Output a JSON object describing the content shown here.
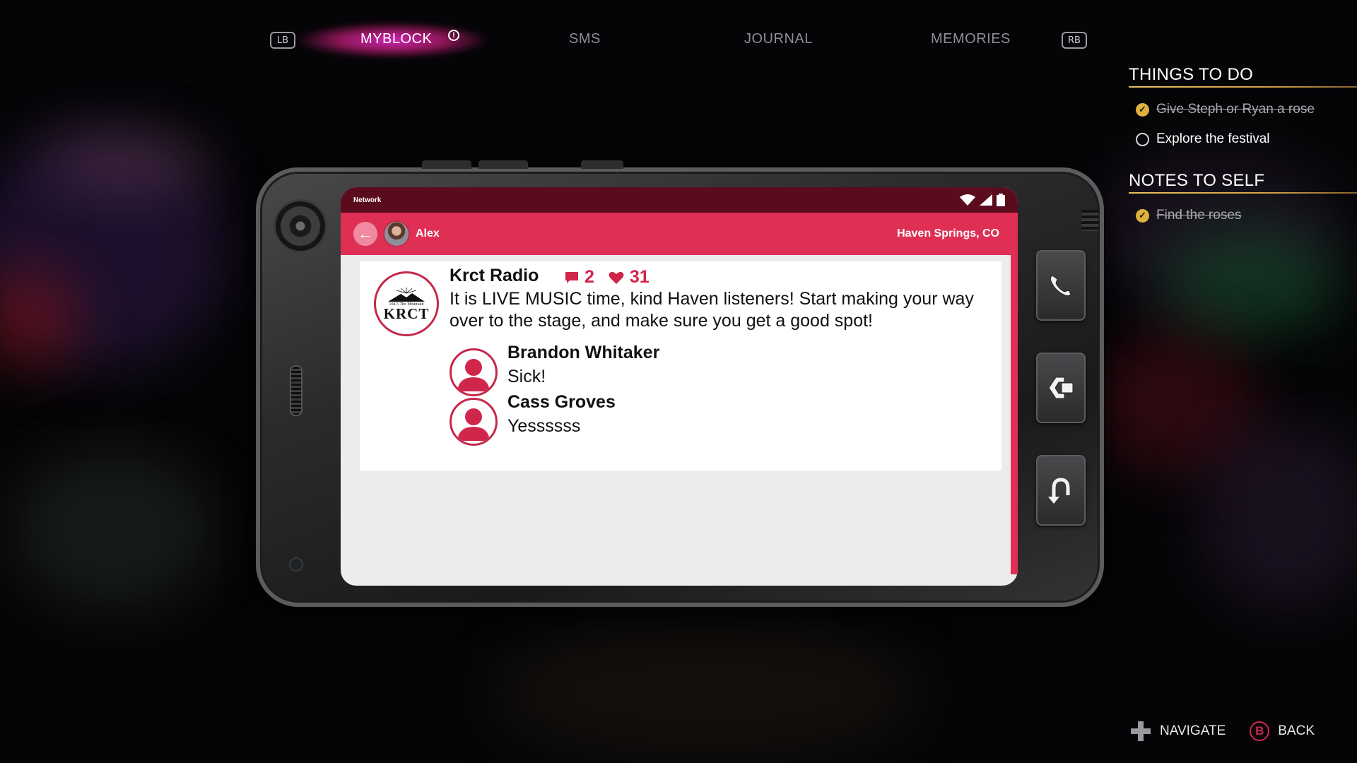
{
  "nav": {
    "left_bumper": "LB",
    "right_bumper": "RB",
    "tabs": [
      {
        "label": "MYBLOCK",
        "active": true,
        "alert": true
      },
      {
        "label": "SMS",
        "active": false
      },
      {
        "label": "JOURNAL",
        "active": false
      },
      {
        "label": "MEMORIES",
        "active": false
      }
    ],
    "alert_icon": "alert-icon"
  },
  "side_panel": {
    "things_to_do": {
      "title": "THINGS TO DO",
      "items": [
        {
          "text": "Give Steph or Ryan a rose",
          "done": true
        },
        {
          "text": "Explore the festival",
          "done": false
        }
      ]
    },
    "notes_to_self": {
      "title": "NOTES TO SELF",
      "items": [
        {
          "text": "Find the roses",
          "done": true
        }
      ]
    }
  },
  "phone": {
    "status_bar": {
      "network_label": "Network",
      "icons": [
        "wifi-icon",
        "signal-icon",
        "battery-icon"
      ]
    },
    "app_bar": {
      "user": "Alex",
      "location": "Haven Springs, CO"
    },
    "post": {
      "author": "Krct Radio",
      "logo_text": "KRCT",
      "logo_small_text": "104.5 The Mountain",
      "comment_count": "2",
      "like_count": "31",
      "body": "It is LIVE MUSIC time, kind Haven listeners! Start making your way over to the stage, and make sure you get a good spot!",
      "comments": [
        {
          "name": "Brandon Whitaker",
          "text": "Sick!"
        },
        {
          "name": "Cass Groves",
          "text": "Yessssss"
        }
      ]
    },
    "side_buttons": [
      "phone-icon",
      "camera-switch-icon",
      "undo-icon"
    ]
  },
  "footer": {
    "navigate_label": "NAVIGATE",
    "back_key": "B",
    "back_label": "BACK"
  },
  "colors": {
    "accent": "#df2f55",
    "status_bar": "#5a0c1d",
    "check_gold": "#e0b23c",
    "tab_glow": "#d628c8"
  }
}
